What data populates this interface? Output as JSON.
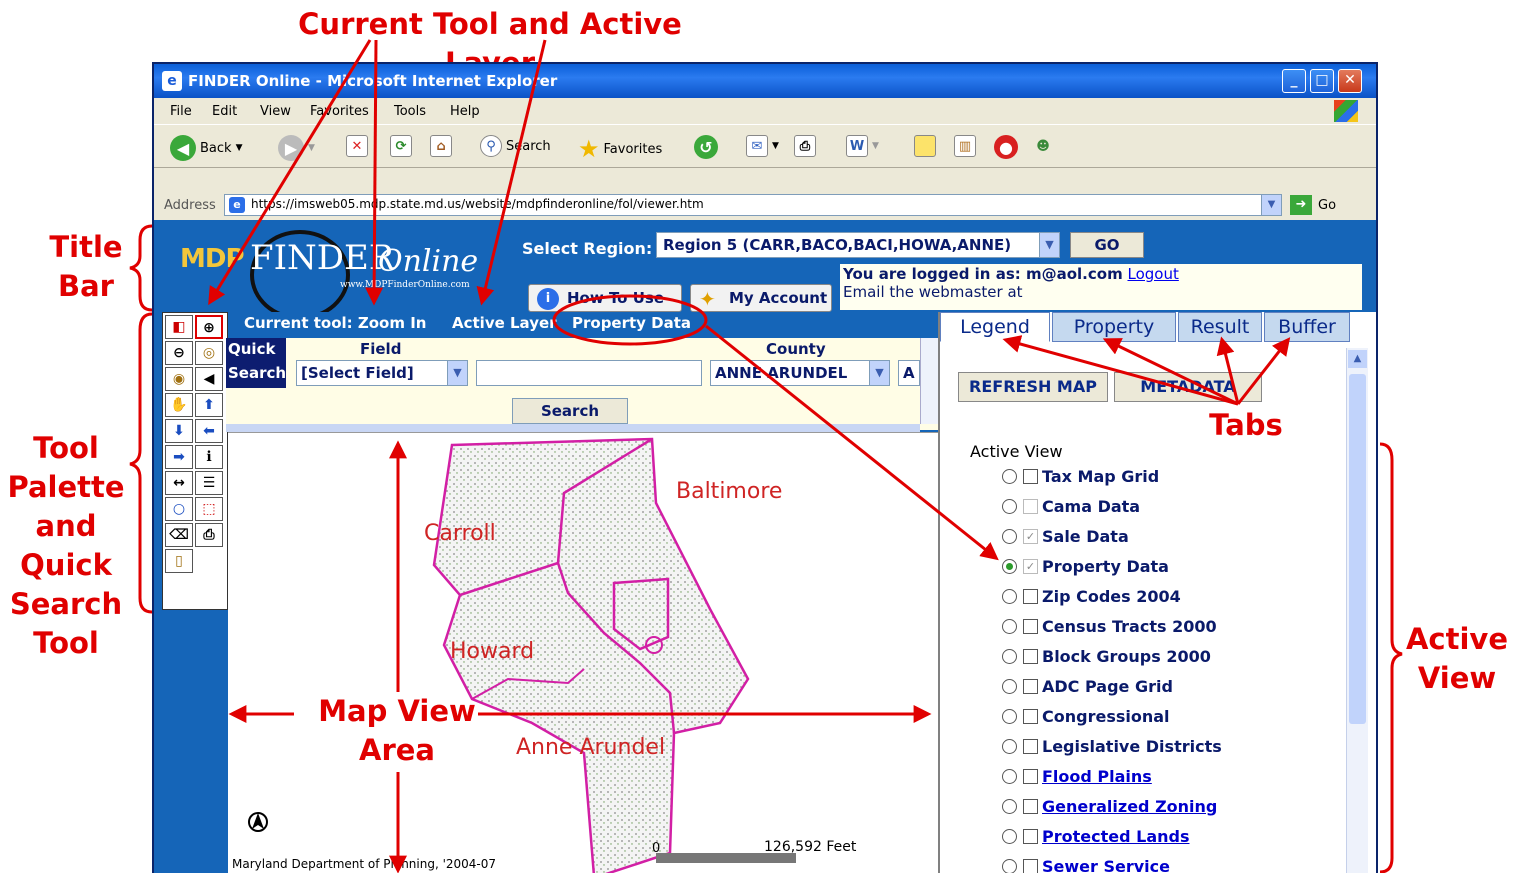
{
  "annotations": {
    "current_tool_and_layer": "Current Tool and Active Layer",
    "title_bar": [
      "Title",
      "Bar"
    ],
    "tool_palette": [
      "Tool",
      "Palette",
      "and",
      "Quick",
      "Search",
      "Tool"
    ],
    "map_view": [
      "Map View",
      "Area"
    ],
    "tabs": "Tabs",
    "active_view": [
      "Active",
      "View"
    ]
  },
  "window": {
    "title": "FINDER Online - Microsoft Internet Explorer",
    "menu": [
      "File",
      "Edit",
      "View",
      "Favorites",
      "Tools",
      "Help"
    ],
    "toolbar": {
      "back": "Back",
      "search": "Search",
      "favorites": "Favorites"
    },
    "address_label": "Address",
    "address_url": "https://imsweb05.mdp.state.md.us/website/mdpfinderonline/fol/viewer.htm",
    "go_label": "Go"
  },
  "header": {
    "logo_mdp": "MDP",
    "logo_finder": "FINDER",
    "logo_online": "Online",
    "logo_url": "www.MDPFinderOnline.com",
    "region_label": "Select Region:",
    "region_value": "Region 5 (CARR,BACO,BACI,HOWA,ANNE)",
    "go": "GO",
    "login_prefix": "You are logged in as: m@aol.com",
    "logout": "Logout",
    "email_line": "Email the webmaster at",
    "how_to_use": "How To Use",
    "my_account": "My Account"
  },
  "status": {
    "current_tool": "Current tool: Zoom In",
    "active_layer_label": "Active Layer",
    "active_layer_value": "Property Data"
  },
  "quick_search": {
    "label1": "Quick",
    "label2": "Search",
    "field_header": "Field",
    "county_header": "County",
    "field_value": "[Select Field]",
    "county_value": "ANNE ARUNDEL",
    "extra": "A",
    "search_button": "Search"
  },
  "map": {
    "labels": {
      "carroll": "Carroll",
      "baltimore": "Baltimore",
      "howard": "Howard",
      "anne_arundel": "Anne Arundel"
    },
    "credit": "Maryland Department of Planning, '2004-07",
    "scale_zero": "0",
    "scale_value": "126,592 Feet"
  },
  "right_panel": {
    "tabs": [
      "Legend",
      "Property",
      "Result",
      "Buffer"
    ],
    "refresh": "REFRESH MAP",
    "metadata": "METADATA",
    "active_view_label": "Active View",
    "layers": [
      {
        "name": "Tax Map Grid",
        "checked": false,
        "selected": false,
        "link": false,
        "dim": false
      },
      {
        "name": "Cama Data",
        "checked": false,
        "selected": false,
        "link": false,
        "dim": true
      },
      {
        "name": "Sale Data",
        "checked": true,
        "selected": false,
        "link": false,
        "dim": true
      },
      {
        "name": "Property Data",
        "checked": true,
        "selected": true,
        "link": false,
        "dim": true
      },
      {
        "name": "Zip Codes 2004",
        "checked": false,
        "selected": false,
        "link": false,
        "dim": false
      },
      {
        "name": "Census Tracts 2000",
        "checked": false,
        "selected": false,
        "link": false,
        "dim": false
      },
      {
        "name": "Block Groups 2000",
        "checked": false,
        "selected": false,
        "link": false,
        "dim": false
      },
      {
        "name": "ADC Page Grid",
        "checked": false,
        "selected": false,
        "link": false,
        "dim": false
      },
      {
        "name": "Congressional",
        "checked": false,
        "selected": false,
        "link": false,
        "dim": false
      },
      {
        "name": "Legislative Districts",
        "checked": false,
        "selected": false,
        "link": false,
        "dim": false
      },
      {
        "name": "Flood Plains",
        "checked": false,
        "selected": false,
        "link": true,
        "dim": false
      },
      {
        "name": "Generalized Zoning",
        "checked": false,
        "selected": false,
        "link": true,
        "dim": false
      },
      {
        "name": "Protected Lands",
        "checked": false,
        "selected": false,
        "link": true,
        "dim": false
      },
      {
        "name": "Sewer Service",
        "checked": false,
        "selected": false,
        "link": true,
        "dim": false
      }
    ]
  },
  "colors": {
    "annotation": "#e00000",
    "page_blue": "#1565b8",
    "map_boundary": "#d21fa5"
  }
}
